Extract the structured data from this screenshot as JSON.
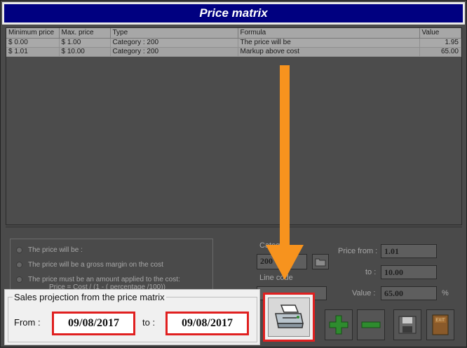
{
  "window": {
    "title": "Price matrix"
  },
  "grid": {
    "columns": [
      "Minimum price",
      "Max. price",
      "Type",
      "Formula",
      "Value"
    ],
    "rows": [
      [
        "$ 0.00",
        "$ 1.00",
        "Category : 200",
        "The price will be",
        "1.95"
      ],
      [
        "$ 1.01",
        "$ 10.00",
        "Category : 200",
        "Markup above cost",
        "65.00"
      ]
    ]
  },
  "options": {
    "radios": [
      "The price will be :",
      "The price will be a gross margin on the cost",
      "The price must be an amount applied to the cost:"
    ],
    "formula": "Price = Cost / (1 - ( percentage /100))",
    "category_label": "Categ",
    "category_value": "200",
    "line_code_label": "Line code",
    "price_from_label": "Price from :",
    "price_from_value": "1.01",
    "to_label": "to :",
    "to_value": "10.00",
    "value_label": "Value :",
    "value_value": "65.00",
    "percent_sign": "%"
  },
  "projection": {
    "legend": "Sales projection from the price matrix",
    "from_label": "From :",
    "from_date": "09/08/2017",
    "to_label": "to :",
    "to_date": "09/08/2017"
  },
  "icons": {
    "print": "printer-icon",
    "add": "plus-icon",
    "remove": "minus-icon",
    "save": "floppy-disk-icon",
    "exit": "exit-icon",
    "lookup": "folder-icon"
  },
  "colors": {
    "title_bar": "#000080",
    "highlight": "#e02020",
    "arrow": "#f7931e"
  }
}
